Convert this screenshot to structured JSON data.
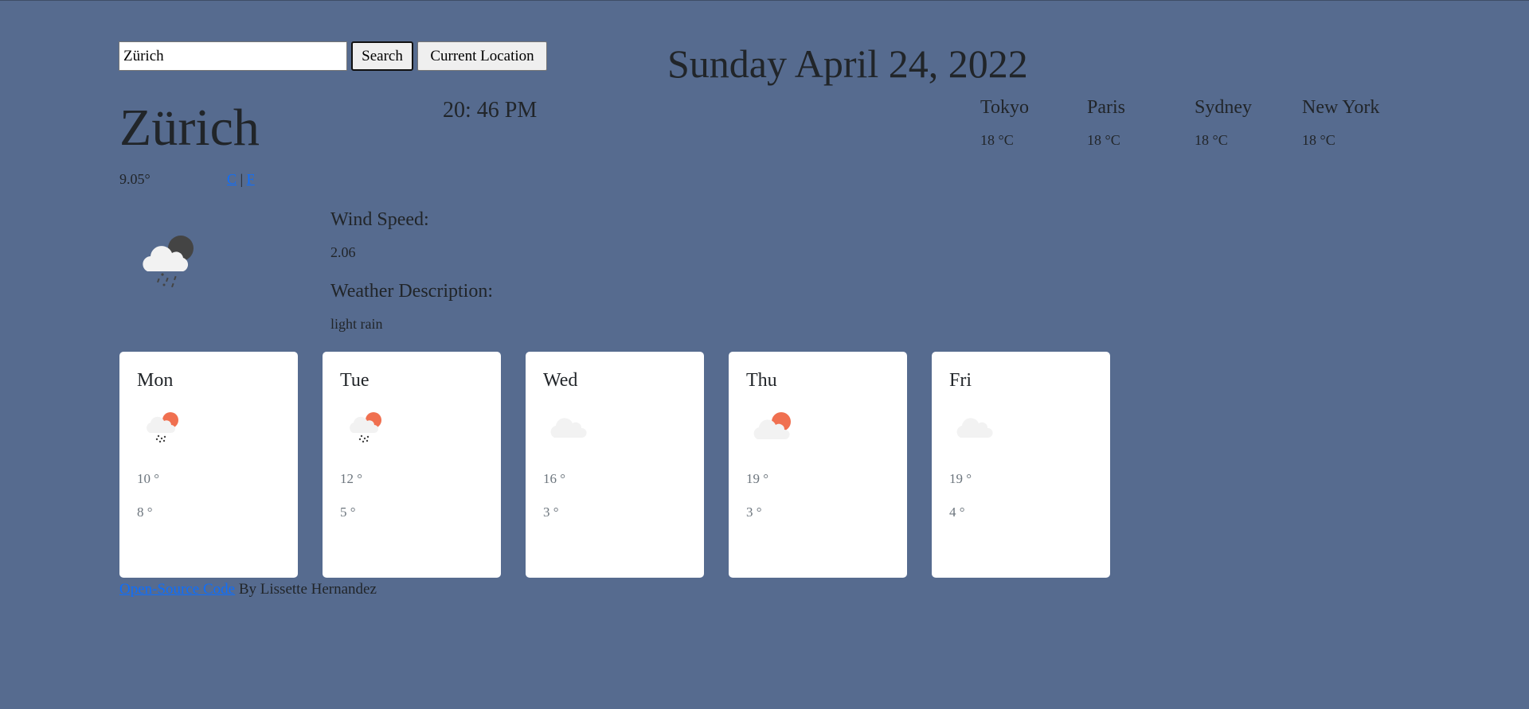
{
  "search": {
    "value": "Zürich",
    "search_label": "Search",
    "location_label": "Current Location"
  },
  "date": "Sunday April 24, 2022",
  "current": {
    "city": "Zürich",
    "time": "20: 46 PM",
    "temperature": "9.05°",
    "unit_c": "C",
    "unit_sep": "|",
    "unit_f": "F",
    "icon": "rain-night-cloud-icon",
    "wind_label": "Wind Speed:",
    "wind_value": "2.06",
    "desc_label": "Weather Description:",
    "desc_value": "light rain"
  },
  "other_cities": [
    {
      "name": "Tokyo",
      "temp": "18 °C"
    },
    {
      "name": "Paris",
      "temp": "18 °C"
    },
    {
      "name": "Sydney",
      "temp": "18 °C"
    },
    {
      "name": "New York",
      "temp": "18 °C"
    }
  ],
  "forecast": [
    {
      "day": "Mon",
      "icon": "rain-sun-cloud-icon",
      "high": "10 °",
      "low": "8 °"
    },
    {
      "day": "Tue",
      "icon": "rain-sun-cloud-icon",
      "high": "12 °",
      "low": "5 °"
    },
    {
      "day": "Wed",
      "icon": "cloud-icon",
      "high": "16 °",
      "low": "3 °"
    },
    {
      "day": "Thu",
      "icon": "sun-cloud-icon",
      "high": "19 °",
      "low": "3 °"
    },
    {
      "day": "Fri",
      "icon": "cloud-icon",
      "high": "19 °",
      "low": "4 °"
    }
  ],
  "footer": {
    "link": "Open-Source Code",
    "text": " By Lissette Hernandez"
  },
  "colors": {
    "background": "#566b8f",
    "sun": "#f07050",
    "cloud": "#f2f2f2",
    "moon": "#444444",
    "link": "#0d6efd"
  }
}
